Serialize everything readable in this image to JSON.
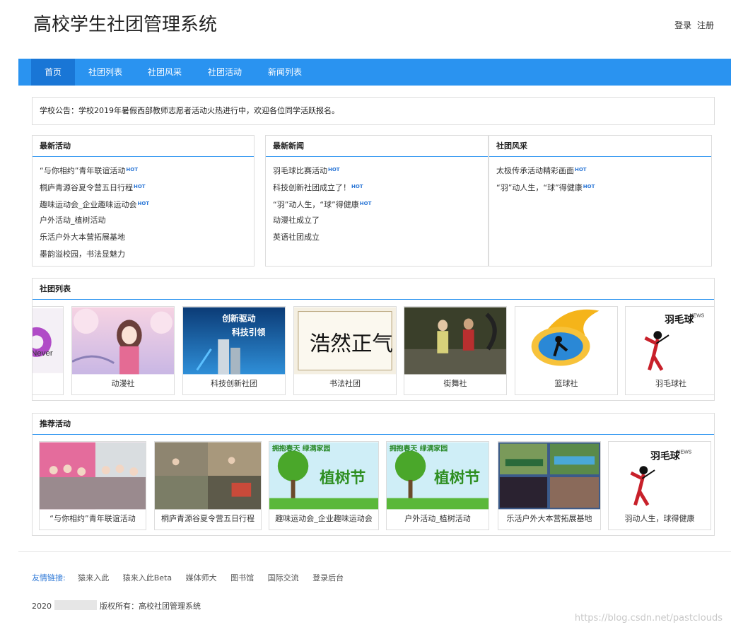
{
  "header": {
    "title": "高校学生社团管理系统",
    "login": "登录",
    "register": "注册"
  },
  "nav": [
    {
      "label": "首页",
      "active": true
    },
    {
      "label": "社团列表"
    },
    {
      "label": "社团风采"
    },
    {
      "label": "社团活动"
    },
    {
      "label": "新闻列表"
    }
  ],
  "notice": "学校公告：学校2019年暑假西部教师志愿者活动火热进行中，欢迎各位同学活跃报名。",
  "panels": {
    "latest_activities": {
      "title": "最新活动",
      "items": [
        "“与你相约”青年联谊活动",
        "桐庐青源谷夏令营五日行程",
        "趣味运动会_企业趣味运动会",
        "户外活动_植树活动",
        "乐活户外大本营拓展基地",
        "墨韵溢校园，书法显魅力"
      ],
      "hot": [
        true,
        true,
        true,
        false,
        false,
        false
      ]
    },
    "latest_news": {
      "title": "最新新闻",
      "items": [
        "羽毛球比赛活动",
        "科技创新社团成立了！",
        "“羽”动人生，“球”得健康",
        "动漫社成立了",
        "英语社团成立"
      ],
      "hot": [
        true,
        true,
        true,
        false,
        false
      ]
    },
    "club_style": {
      "title": "社团风采",
      "items": [
        "太极传承活动精彩画面",
        "“羽”动人生，“球”得健康"
      ],
      "hot": [
        true,
        true
      ]
    }
  },
  "hot_label": "HOT",
  "club_list": {
    "title": "社团列表",
    "clubs": [
      "",
      "动漫社",
      "科技创新社团",
      "书法社团",
      "街舞社",
      "篮球社",
      "羽毛球社"
    ]
  },
  "recommended": {
    "title": "推荐活动",
    "items": [
      "“与你相约”青年联谊活动",
      "桐庐青源谷夏令营五日行程",
      "趣味运动会_企业趣味运动会",
      "户外活动_植树活动",
      "乐活户外大本营拓展基地",
      "羽动人生，球得健康"
    ]
  },
  "thumb_text": {
    "never": "Never",
    "tech1": "创新驱动",
    "tech2": "科技引领",
    "calligraphy": "浩然正气",
    "badminton": "羽毛球",
    "badminton_news": "NEWS",
    "tree_banner": "拥抱春天 绿满家园",
    "tree_title": "植树节"
  },
  "footer": {
    "links_label": "友情链接:",
    "links": [
      "猿来入此",
      "猿来入此Beta",
      "媒体师大",
      "图书馆",
      "国际交流",
      "登录后台"
    ],
    "copyright_prefix": "2020",
    "copyright_suffix": "版权所有：高校社团管理系统",
    "watermark": "https://blog.csdn.net/pastclouds"
  },
  "colors": {
    "primary": "#2a93f0",
    "nav_active": "#1976d6",
    "hot": "#2a76d6"
  }
}
